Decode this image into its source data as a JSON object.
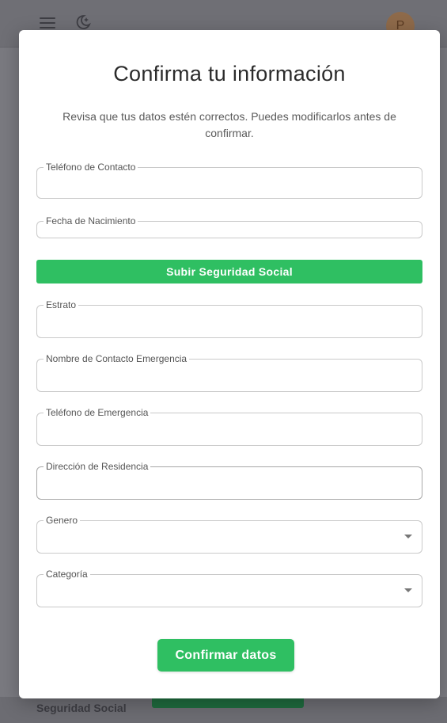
{
  "background": {
    "avatar_initial": "P",
    "footer_text": "Seguridad Social"
  },
  "modal": {
    "title": "Confirma tu información",
    "description": "Revisa que tus datos estén correctos. Puedes modificarlos antes de confirmar.",
    "fields": {
      "telefono_contacto": {
        "label": "Teléfono de Contacto",
        "value": ""
      },
      "fecha_nacimiento": {
        "label": "Fecha de Nacimiento",
        "value": ""
      },
      "estrato": {
        "label": "Estrato",
        "value": ""
      },
      "nombre_emergencia": {
        "label": "Nombre de Contacto Emergencia",
        "value": ""
      },
      "telefono_emergencia": {
        "label": "Teléfono de Emergencia",
        "value": ""
      },
      "direccion": {
        "label": "Dirección de Residencia",
        "value": ""
      },
      "genero": {
        "label": "Genero",
        "value": ""
      },
      "categoria": {
        "label": "Categoría",
        "value": ""
      }
    },
    "upload_button_label": "Subir Seguridad Social",
    "confirm_button_label": "Confirmar datos"
  },
  "colors": {
    "accent_green": "#2fbf62",
    "overlay": "#7a7a80"
  },
  "icons": [
    "hamburger-menu-icon",
    "theme-toggle-icon",
    "dropdown-arrow-icon"
  ]
}
